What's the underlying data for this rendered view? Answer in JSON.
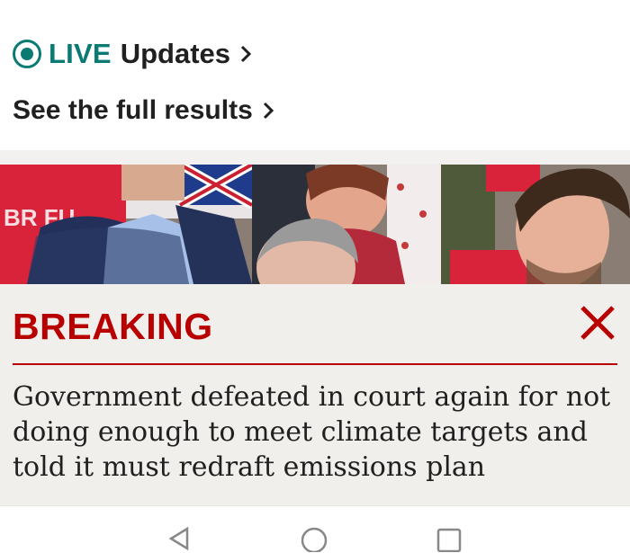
{
  "live_updates": {
    "live_label": "LIVE",
    "updates_label": "Updates",
    "icon": "live-dot-icon",
    "accent_color": "#0a7a73"
  },
  "results_link": {
    "label": "See the full results"
  },
  "photo": {
    "banner_text": "BR FU"
  },
  "breaking": {
    "title": "BREAKING",
    "headline": "Government defeated in court again for not doing enough to meet climate targets and told it must redraft emissions plan",
    "accent_color": "#b80000",
    "close_icon": "close-icon"
  },
  "navigation_bar": {
    "icons": [
      "back-triangle-icon",
      "home-circle-icon",
      "recents-square-icon"
    ]
  }
}
